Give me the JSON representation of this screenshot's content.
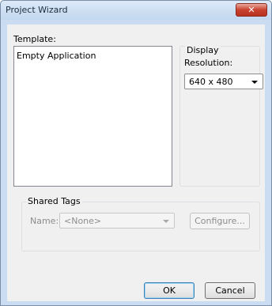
{
  "window": {
    "title": "Project Wizard",
    "close_glyph": "✕"
  },
  "template": {
    "label": "Template:",
    "items": [
      "Empty Application"
    ]
  },
  "display": {
    "group_label": "Display",
    "resolution_label": "Resolution:",
    "resolution_value": "640 x 480"
  },
  "shared_tags": {
    "group_label": "Shared Tags",
    "name_label": "Name:",
    "name_value": "<None>",
    "configure_label": "Configure..."
  },
  "buttons": {
    "ok_label": "OK",
    "cancel_label": "Cancel"
  },
  "colors": {
    "close_button": "#c9412f",
    "default_button_border": "#3c7fb1"
  }
}
